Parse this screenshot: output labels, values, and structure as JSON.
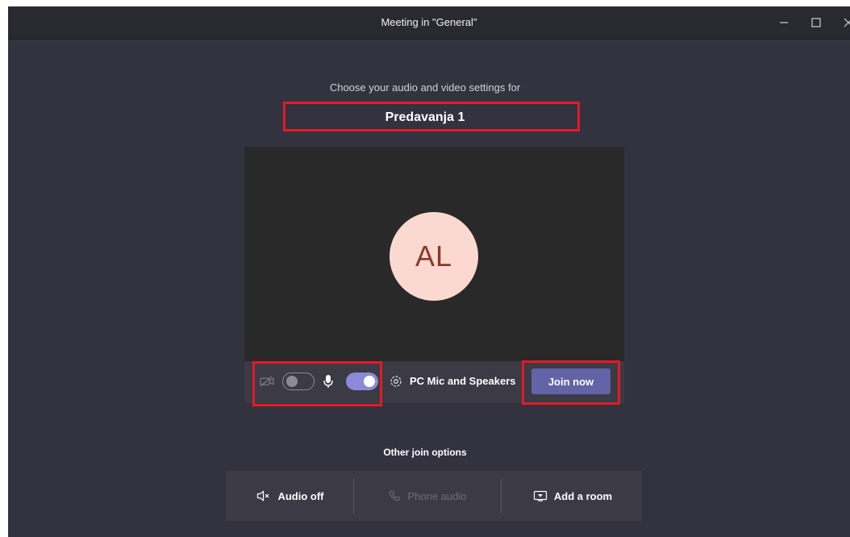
{
  "window": {
    "title": "Meeting in \"General\"",
    "controls": [
      "minimize-icon",
      "maximize-icon",
      "close-icon"
    ]
  },
  "prejoin": {
    "subtitle": "Choose your audio and video settings for",
    "meeting_name": "Predavanja 1",
    "avatar_initials": "AL",
    "avatar_bg": "#fbd9d0",
    "avatar_fg": "#8a3a2a"
  },
  "controls": {
    "camera": {
      "icon": "video-off-icon",
      "enabled": false
    },
    "microphone": {
      "icon": "microphone-icon",
      "enabled": true
    },
    "device_settings_icon": "gear-icon",
    "device_label": "PC Mic and Speakers",
    "join_label": "Join now"
  },
  "other_options": {
    "label": "Other join options",
    "items": [
      {
        "label": "Audio off",
        "icon": "speaker-off-icon",
        "enabled": true
      },
      {
        "label": "Phone audio",
        "icon": "phone-icon",
        "enabled": false
      },
      {
        "label": "Add a room",
        "icon": "cast-screen-icon",
        "enabled": true
      }
    ]
  },
  "colors": {
    "background": "#33323f",
    "titlebar": "#292931",
    "preview": "#292929",
    "accent": "#6264a7",
    "toggle_on": "#8a8ad6",
    "highlight": "#e21a25"
  }
}
